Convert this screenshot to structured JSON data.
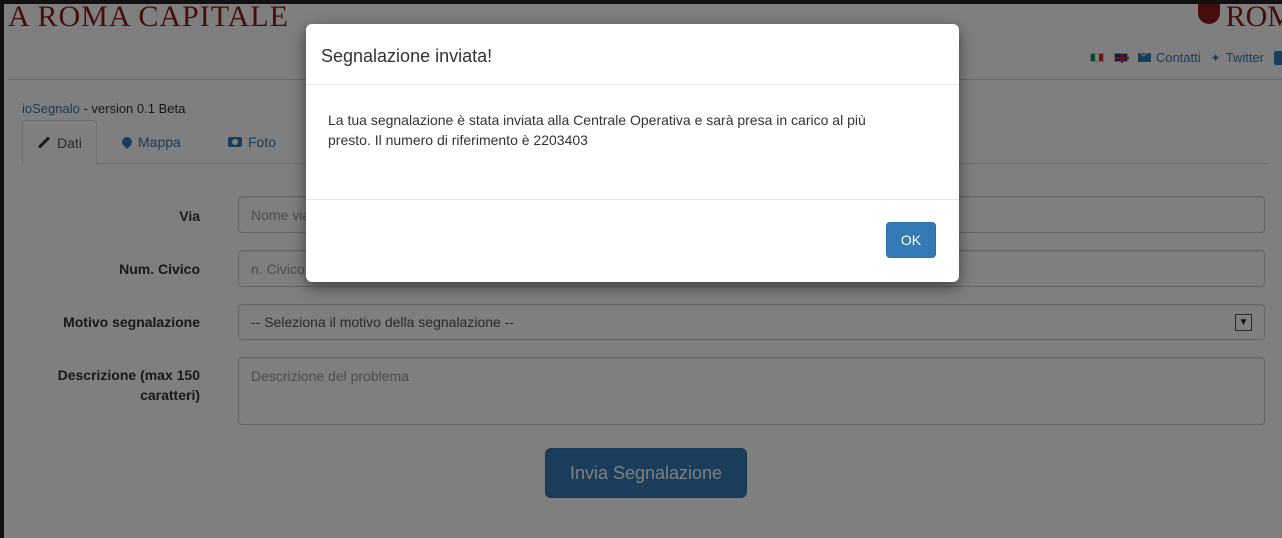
{
  "header": {
    "brand_left": "A ROMA CAPITALE",
    "brand_right": "ROM",
    "nav": {
      "contact_label": "Contatti",
      "twitter_label": "Twitter"
    }
  },
  "app": {
    "name": "ioSegnalo",
    "version_text": " - version 0.1 Beta"
  },
  "tabs": [
    {
      "label": "Dati",
      "icon": "pencil-icon",
      "active": true
    },
    {
      "label": "Mappa",
      "icon": "map-marker-icon",
      "active": false
    },
    {
      "label": "Foto",
      "icon": "camera-icon",
      "active": false
    }
  ],
  "form": {
    "via": {
      "label": "Via",
      "placeholder": "Nome via"
    },
    "civico": {
      "label": "Num. Civico",
      "placeholder": "n. Civico"
    },
    "motivo": {
      "label": "Motivo segnalazione",
      "value": "-- Seleziona il motivo della segnalazione --"
    },
    "descrizione": {
      "label_line1": "Descrizione (max 150",
      "label_line2": "caratteri)",
      "placeholder": "Descrizione del problema"
    },
    "submit_label": "Invia Segnalazione"
  },
  "modal": {
    "title": "Segnalazione inviata!",
    "body_line1": "La tua segnalazione è stata inviata alla Centrale Operativa e sarà presa in carico al più",
    "body_line2": "presto. Il numero di riferimento è 2203403",
    "ok_label": "OK"
  },
  "colors": {
    "primary": "#337ab7",
    "brand": "#8b1a1a",
    "backdrop": "rgba(0,0,0,0.5)"
  }
}
